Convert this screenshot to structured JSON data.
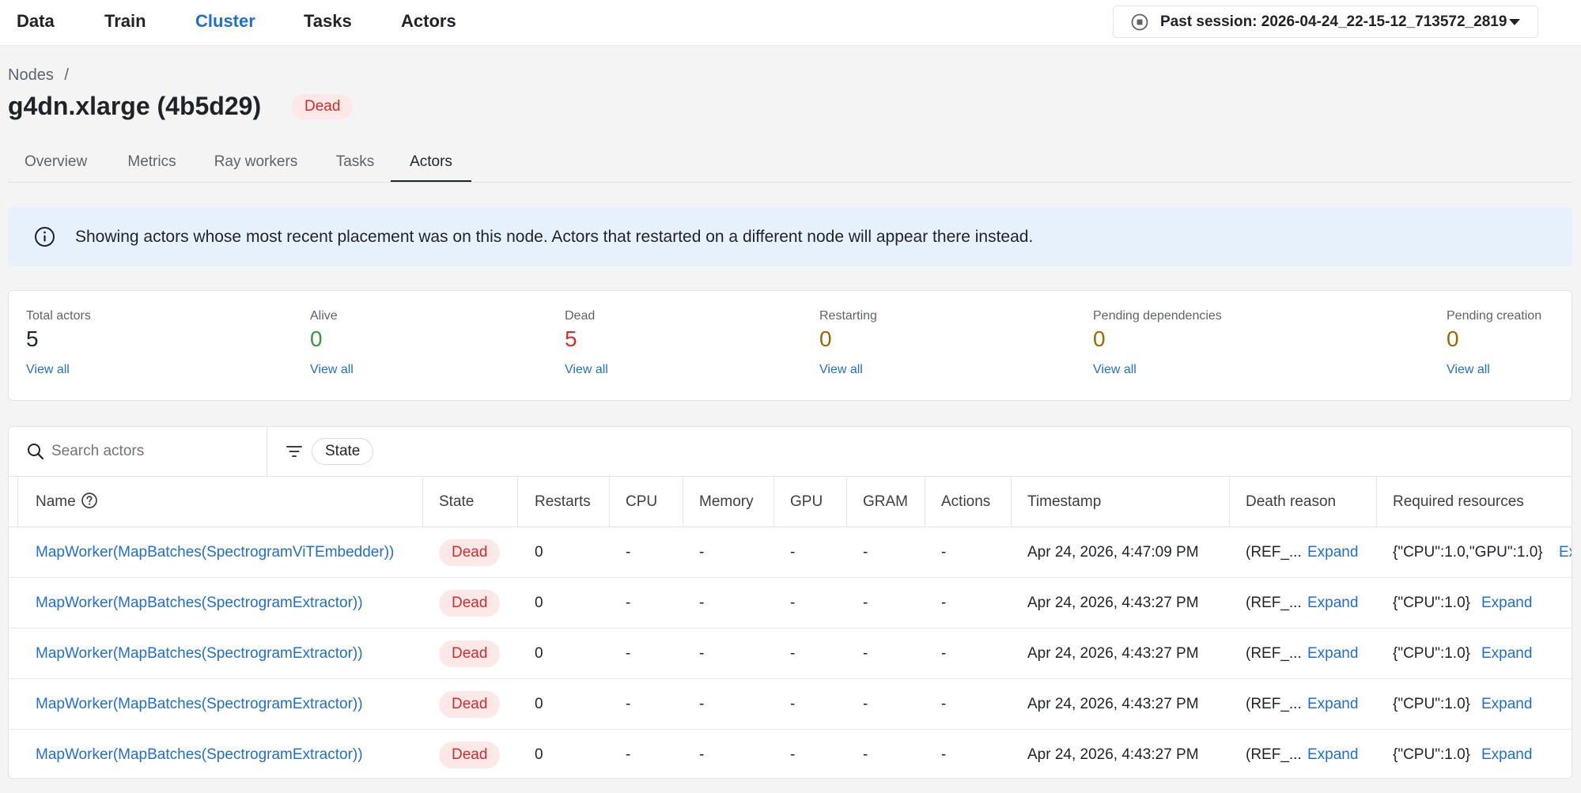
{
  "nav": {
    "items": [
      "Data",
      "Train",
      "Cluster",
      "Tasks",
      "Actors"
    ],
    "active": "Cluster",
    "session": "Past session: 2026-04-24_22-15-12_713572_2819"
  },
  "breadcrumb": {
    "parent": "Nodes",
    "separator": "/"
  },
  "page": {
    "title": "g4dn.xlarge (4b5d29)",
    "status": "Dead"
  },
  "tabs": [
    "Overview",
    "Metrics",
    "Ray workers",
    "Tasks",
    "Actors"
  ],
  "active_tab": "Actors",
  "banner": {
    "text": "Showing actors whose most recent placement was on this node. Actors that restarted on a different node will appear there instead."
  },
  "stats": [
    {
      "label": "Total actors",
      "value": "5",
      "link": "View all",
      "color": "#1f2328"
    },
    {
      "label": "Alive",
      "value": "0",
      "link": "View all",
      "color": "#3a9a3f"
    },
    {
      "label": "Dead",
      "value": "5",
      "link": "View all",
      "color": "#d0312d"
    },
    {
      "label": "Restarting",
      "value": "0",
      "link": "View all",
      "color": "#9a6a00"
    },
    {
      "label": "Pending dependencies",
      "value": "0",
      "link": "View all",
      "color": "#9a6a00"
    },
    {
      "label": "Pending creation",
      "value": "0",
      "link": "View all",
      "color": "#9a6a00"
    }
  ],
  "toolbar": {
    "search_placeholder": "Search actors",
    "filter_chip": "State"
  },
  "table": {
    "columns": [
      "Name",
      "State",
      "Restarts",
      "CPU",
      "Memory",
      "GPU",
      "GRAM",
      "Actions",
      "Timestamp",
      "Death reason",
      "Required resources"
    ],
    "rows": [
      {
        "name": "MapWorker(MapBatches(SpectrogramViTEmbedder))",
        "state": "Dead",
        "restarts": "0",
        "cpu": "-",
        "memory": "-",
        "gpu": "-",
        "gram": "-",
        "actions": "-",
        "timestamp": "Apr 24, 2026, 4:47:09 PM",
        "death_reason": "(REF_...",
        "death_expand": "Expand",
        "resources": "{\"CPU\":1.0,\"GPU\":1.0}",
        "resources_expand": "Expand"
      },
      {
        "name": "MapWorker(MapBatches(SpectrogramExtractor))",
        "state": "Dead",
        "restarts": "0",
        "cpu": "-",
        "memory": "-",
        "gpu": "-",
        "gram": "-",
        "actions": "-",
        "timestamp": "Apr 24, 2026, 4:43:27 PM",
        "death_reason": "(REF_...",
        "death_expand": "Expand",
        "resources": "{\"CPU\":1.0}",
        "resources_expand": "Expand"
      },
      {
        "name": "MapWorker(MapBatches(SpectrogramExtractor))",
        "state": "Dead",
        "restarts": "0",
        "cpu": "-",
        "memory": "-",
        "gpu": "-",
        "gram": "-",
        "actions": "-",
        "timestamp": "Apr 24, 2026, 4:43:27 PM",
        "death_reason": "(REF_...",
        "death_expand": "Expand",
        "resources": "{\"CPU\":1.0}",
        "resources_expand": "Expand"
      },
      {
        "name": "MapWorker(MapBatches(SpectrogramExtractor))",
        "state": "Dead",
        "restarts": "0",
        "cpu": "-",
        "memory": "-",
        "gpu": "-",
        "gram": "-",
        "actions": "-",
        "timestamp": "Apr 24, 2026, 4:43:27 PM",
        "death_reason": "(REF_...",
        "death_expand": "Expand",
        "resources": "{\"CPU\":1.0}",
        "resources_expand": "Expand"
      },
      {
        "name": "MapWorker(MapBatches(SpectrogramExtractor))",
        "state": "Dead",
        "restarts": "0",
        "cpu": "-",
        "memory": "-",
        "gpu": "-",
        "gram": "-",
        "actions": "-",
        "timestamp": "Apr 24, 2026, 4:43:27 PM",
        "death_reason": "(REF_...",
        "death_expand": "Expand",
        "resources": "{\"CPU\":1.0}",
        "resources_expand": "Expand"
      }
    ]
  }
}
